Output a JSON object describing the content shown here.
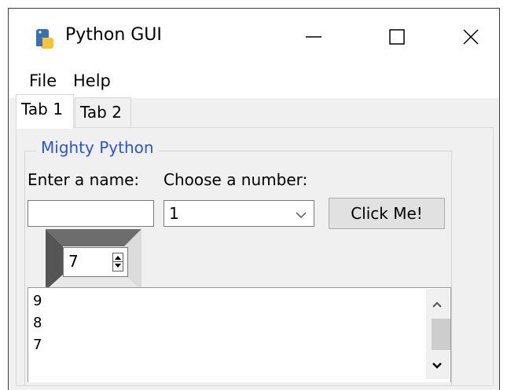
{
  "window": {
    "title": "Python GUI",
    "controls": [
      "minimize",
      "maximize",
      "close"
    ]
  },
  "menu": {
    "items": [
      "File",
      "Help"
    ]
  },
  "tabs": [
    {
      "label": "Tab 1",
      "selected": true
    },
    {
      "label": "Tab 2",
      "selected": false
    }
  ],
  "group": {
    "title": "Mighty Python",
    "title_color": "#2a55d4",
    "name_label": "Enter a name:",
    "name_value": "",
    "number_label": "Choose a number:",
    "number_value": "1",
    "button_label": "Click Me!",
    "spinbox_value": "7",
    "text_lines": [
      "9",
      "8",
      "7"
    ]
  },
  "icons": {
    "app": "python-logo-icon",
    "minimize": "minimize-icon",
    "maximize": "maximize-icon",
    "close": "close-icon",
    "combo": "chevron-down-icon"
  }
}
